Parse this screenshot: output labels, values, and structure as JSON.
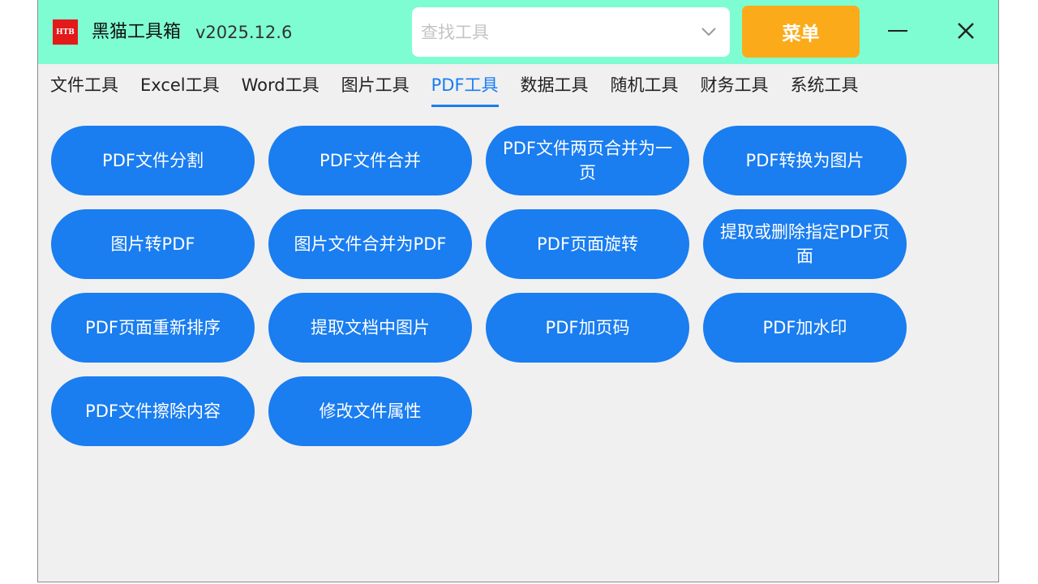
{
  "app": {
    "logo_text": "HTB",
    "title": "黑猫工具箱",
    "version": "v2025.12.6"
  },
  "search": {
    "placeholder": "查找工具",
    "value": ""
  },
  "header": {
    "menu_label": "菜单",
    "minimize_icon": "minimize-icon",
    "close_icon": "close-icon"
  },
  "tabs": [
    {
      "label": "文件工具",
      "active": false
    },
    {
      "label": "Excel工具",
      "active": false
    },
    {
      "label": "Word工具",
      "active": false
    },
    {
      "label": "图片工具",
      "active": false
    },
    {
      "label": "PDF工具",
      "active": true
    },
    {
      "label": "数据工具",
      "active": false
    },
    {
      "label": "随机工具",
      "active": false
    },
    {
      "label": "财务工具",
      "active": false
    },
    {
      "label": "系统工具",
      "active": false
    }
  ],
  "tools": [
    "PDF文件分割",
    "PDF文件合并",
    "PDF文件两页合并为一页",
    "PDF转换为图片",
    "图片转PDF",
    "图片文件合并为PDF",
    "PDF页面旋转",
    "提取或删除指定PDF页面",
    "PDF页面重新排序",
    "提取文档中图片",
    "PDF加页码",
    "PDF加水印",
    "PDF文件擦除内容",
    "修改文件属性"
  ],
  "colors": {
    "titlebar": "#7ffdd2",
    "accent": "#1a7df0",
    "menu": "#fbab19",
    "logo": "#e21a1a",
    "background": "#f0f0f0"
  }
}
